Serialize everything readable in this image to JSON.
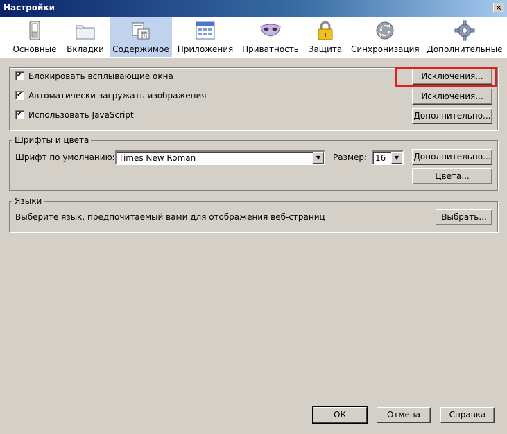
{
  "window": {
    "title": "Настройки",
    "close_glyph": "✕"
  },
  "toolbar": {
    "items": [
      {
        "label": "Основные",
        "icon": "switch-icon"
      },
      {
        "label": "Вкладки",
        "icon": "folder-tabs-icon"
      },
      {
        "label": "Содержимое",
        "icon": "content-icon"
      },
      {
        "label": "Приложения",
        "icon": "applications-icon"
      },
      {
        "label": "Приватность",
        "icon": "mask-icon"
      },
      {
        "label": "Защита",
        "icon": "lock-icon"
      },
      {
        "label": "Синхронизация",
        "icon": "sync-icon"
      },
      {
        "label": "Дополнительные",
        "icon": "gear-icon"
      }
    ],
    "active_label": "Содержимое"
  },
  "content": {
    "popups_label": "Блокировать всплывающие окна",
    "images_label": "Автоматически загружать изображения",
    "js_label": "Использовать JavaScript",
    "exceptions1": "Исключения...",
    "exceptions2": "Исключения...",
    "advanced_js": "Дополнительно..."
  },
  "fonts": {
    "group_title": "Шрифты и цвета",
    "default_font_label": "Шрифт по умолчанию:",
    "default_font_value": "Times New Roman",
    "size_label": "Размер:",
    "size_value": "16",
    "advanced": "Дополнительно...",
    "colors": "Цвета..."
  },
  "languages": {
    "group_title": "Языки",
    "description": "Выберите язык, предпочитаемый вами для отображения веб-страниц",
    "choose": "Выбрать..."
  },
  "footer": {
    "ok": "ОК",
    "cancel": "Отмена",
    "help": "Справка"
  },
  "colors": {
    "titlebar_start": "#0a246a",
    "active_tab": "#c1d2ee",
    "highlight_border": "#e02020",
    "dialog_bg": "#d4d0c8"
  }
}
